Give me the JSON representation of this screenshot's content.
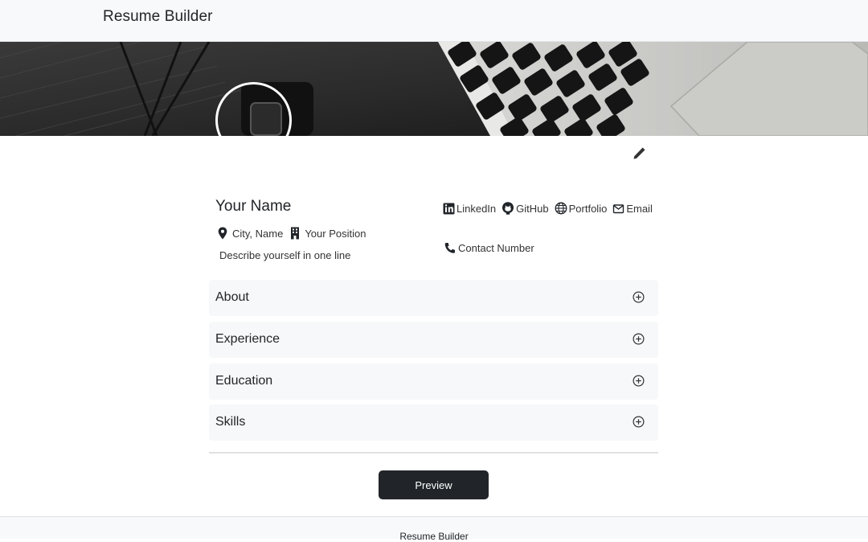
{
  "navbar": {
    "brand": "Resume Builder"
  },
  "cover": {
    "image": "laptop keyboard photo"
  },
  "profile": {
    "name": "Your Name",
    "location": "City, Name",
    "position": "Your Position",
    "tagline": "Describe yourself in one line",
    "links": [
      {
        "label": "LinkedIn",
        "icon": "linkedin-icon"
      },
      {
        "label": "GitHub",
        "icon": "github-icon"
      },
      {
        "label": "Portfolio",
        "icon": "globe-icon"
      },
      {
        "label": "Email",
        "icon": "envelope-icon"
      }
    ],
    "phone": "Contact Number"
  },
  "sections": [
    {
      "label": "About",
      "icon": "plus-circle-icon"
    },
    {
      "label": "Experience",
      "icon": "plus-circle-icon"
    },
    {
      "label": "Education",
      "icon": "plus-circle-icon"
    },
    {
      "label": "Skills",
      "icon": "plus-circle-icon"
    }
  ],
  "actions": {
    "preview_label": "Preview"
  },
  "footer": {
    "text": "Resume Builder"
  },
  "colors": {
    "dark": "#212529",
    "light_bg": "#f8f9fa",
    "section_bg": "#f7f8f9"
  }
}
